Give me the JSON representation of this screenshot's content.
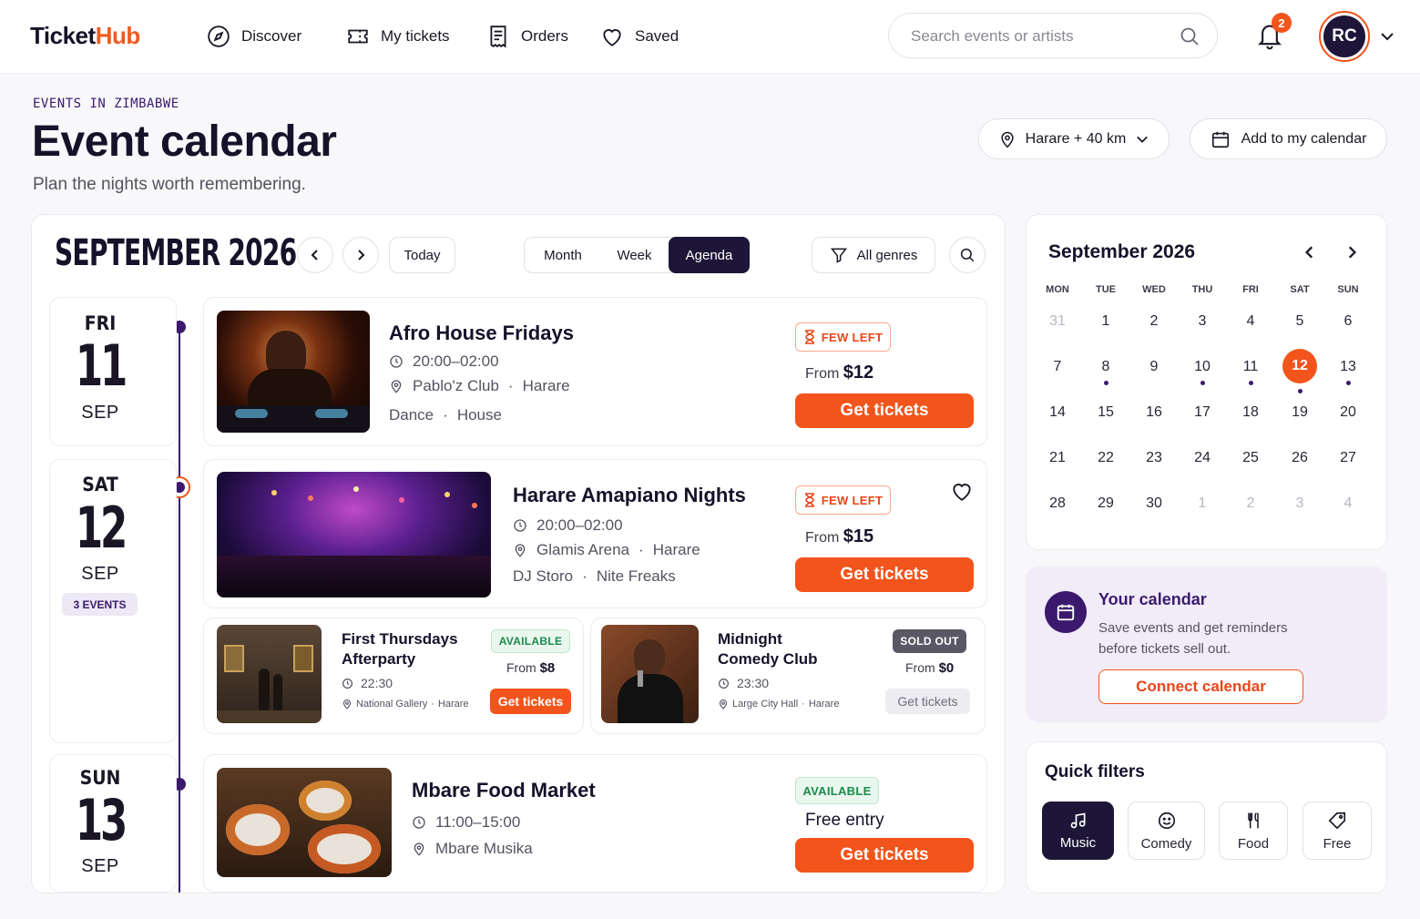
{
  "brand": {
    "part1": "Ticket",
    "part2": "Hub"
  },
  "nav": [
    {
      "label": "Discover",
      "icon": "compass-icon"
    },
    {
      "label": "My tickets",
      "icon": "ticket-icon"
    },
    {
      "label": "Orders",
      "icon": "receipt-icon"
    },
    {
      "label": "Saved",
      "icon": "heart-icon"
    }
  ],
  "search": {
    "placeholder": "Search events or artists"
  },
  "notifications": {
    "count": "2"
  },
  "user": {
    "initials": "RC"
  },
  "page": {
    "eyebrow": "EVENTS IN ZIMBABWE",
    "title": "Event calendar",
    "subtitle": "Plan the nights worth remembering.",
    "location": "Harare + 40 km",
    "add_calendar": "Add to my calendar"
  },
  "agenda": {
    "month_title": "SEPTEMBER 2026",
    "today": "Today",
    "views": [
      "Month",
      "Week",
      "Agenda"
    ],
    "active_view": "Agenda",
    "genre_filter": "All genres"
  },
  "days": [
    {
      "dow": "FRI",
      "day": "11",
      "month": "SEP"
    },
    {
      "dow": "SAT",
      "day": "12",
      "month": "SEP",
      "count": "3 EVENTS"
    },
    {
      "dow": "SUN",
      "day": "13",
      "month": "SEP"
    }
  ],
  "events": {
    "afro": {
      "title": "Afro House Fridays",
      "time": "20:00–02:00",
      "venue": "Pablo'z Club",
      "city": "Harare",
      "tags": [
        "Dance",
        "House"
      ],
      "badge": "FEW LEFT",
      "from": "From",
      "price": "$12",
      "cta": "Get tickets"
    },
    "amapiano": {
      "title": "Harare Amapiano Nights",
      "time": "20:00–02:00",
      "venue": "Glamis Arena",
      "city": "Harare",
      "tags": [
        "DJ Storo",
        "Nite Freaks"
      ],
      "badge": "FEW LEFT",
      "from": "From",
      "price": "$15",
      "cta": "Get tickets"
    },
    "thursdays": {
      "title_l1": "First Thursdays",
      "title_l2": "Afterparty",
      "time": "22:30",
      "venue": "National Gallery",
      "city": "Harare",
      "badge": "AVAILABLE",
      "from": "From",
      "price": "$8",
      "cta": "Get tickets"
    },
    "comedy": {
      "title_l1": "Midnight",
      "title_l2": "Comedy Club",
      "time": "23:30",
      "venue": "Large City Hall",
      "city": "Harare",
      "badge": "SOLD OUT",
      "from": "From",
      "price": "$0",
      "cta": "Get tickets"
    },
    "mbare": {
      "title": "Mbare Food Market",
      "time": "11:00–15:00",
      "venue": "Mbare Musika",
      "badge": "AVAILABLE",
      "price_text": "Free entry",
      "cta": "Get tickets"
    }
  },
  "mini_calendar": {
    "title": "September 2026",
    "weekdays": [
      "MON",
      "TUE",
      "WED",
      "THU",
      "FRI",
      "SAT",
      "SUN"
    ],
    "weeks": [
      [
        "31",
        "1",
        "2",
        "3",
        "4",
        "5",
        "6"
      ],
      [
        "7",
        "8",
        "9",
        "10",
        "11",
        "12",
        "13"
      ],
      [
        "14",
        "15",
        "16",
        "17",
        "18",
        "19",
        "20"
      ],
      [
        "21",
        "22",
        "23",
        "24",
        "25",
        "26",
        "27"
      ],
      [
        "28",
        "29",
        "30",
        "1",
        "2",
        "3",
        "4"
      ]
    ],
    "selected": "12",
    "event_days": [
      "8",
      "10",
      "11",
      "12",
      "13"
    ]
  },
  "your_calendar": {
    "title": "Your calendar",
    "line1": "Save events and get reminders",
    "line2": "before tickets sell out.",
    "cta": "Connect calendar"
  },
  "quick_filters": {
    "title": "Quick filters",
    "items": [
      {
        "label": "Music",
        "icon": "music-icon"
      },
      {
        "label": "Comedy",
        "icon": "smile-icon"
      },
      {
        "label": "Food",
        "icon": "fork-knife-icon"
      },
      {
        "label": "Free",
        "icon": "tag-icon"
      }
    ]
  },
  "colors": {
    "accent": "#f2541b",
    "navy": "#1e1638",
    "purple": "#3b1a6e"
  }
}
